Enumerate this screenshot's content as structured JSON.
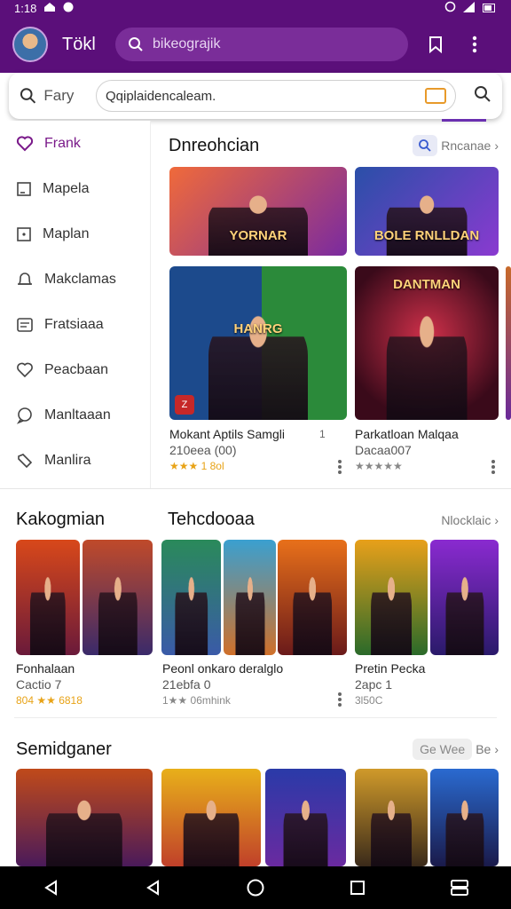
{
  "status_bar": {
    "time": "1:18"
  },
  "app_bar": {
    "title": "Tökl",
    "search_placeholder": "bikeograjik"
  },
  "search_card": {
    "label": "Fary",
    "query": "Qqiplaidencaleam."
  },
  "sidebar": {
    "items": [
      {
        "label": "Frank",
        "icon": "heart-tag-icon"
      },
      {
        "label": "Mapela",
        "icon": "square-icon"
      },
      {
        "label": "Maplan",
        "icon": "square-dot-icon"
      },
      {
        "label": "Makclamas",
        "icon": "bell-icon"
      },
      {
        "label": "Fratsiaaa",
        "icon": "id-card-icon"
      },
      {
        "label": "Peacbaan",
        "icon": "heart-icon"
      },
      {
        "label": "Manltaaan",
        "icon": "chat-icon"
      },
      {
        "label": "Manlira",
        "icon": "tag-icon"
      }
    ]
  },
  "featured": {
    "title": "Dnreohcian",
    "link": "Rncanae",
    "tiles": [
      {
        "caption": "YORNAR",
        "colors": [
          "#f06a3a",
          "#7a2aa0"
        ]
      },
      {
        "caption": "BOLE RNLLDAN",
        "colors": [
          "#2a4fa8",
          "#8a3ad0"
        ]
      },
      {
        "caption": "HANRG",
        "colors": [
          "#1c4a8c",
          "#2b8a3a"
        ]
      },
      {
        "caption": "DANTMAN",
        "colors": [
          "#9a1a2a",
          "#3a0a1a"
        ]
      }
    ],
    "items": [
      {
        "title": "Mokant Aptils Samgli",
        "sub": "210eea (00)",
        "rating": "★★★ 1 8ol",
        "count": "1"
      },
      {
        "title": "Parkatloan Malqaa",
        "sub": "Dacaa007",
        "rating": "★★★★★"
      }
    ]
  },
  "row2": {
    "left_title": "Kakogmian",
    "title": "Tehcdooaa",
    "link": "Nlocklaic",
    "items": [
      {
        "title": "Fonhalaan",
        "sub": "Cactio 7",
        "rating": "804 ★★ 6818"
      },
      {
        "title": "Peonl onkaro deralglo",
        "sub": "21ebfa 0",
        "rating": "1★★ 06mhink"
      },
      {
        "title": "Pretin Pecka",
        "sub": "2apc 1",
        "rating": "3l50C"
      }
    ]
  },
  "row3": {
    "title": "Semidganer",
    "chip": "Ge Wee",
    "link": "Be"
  }
}
